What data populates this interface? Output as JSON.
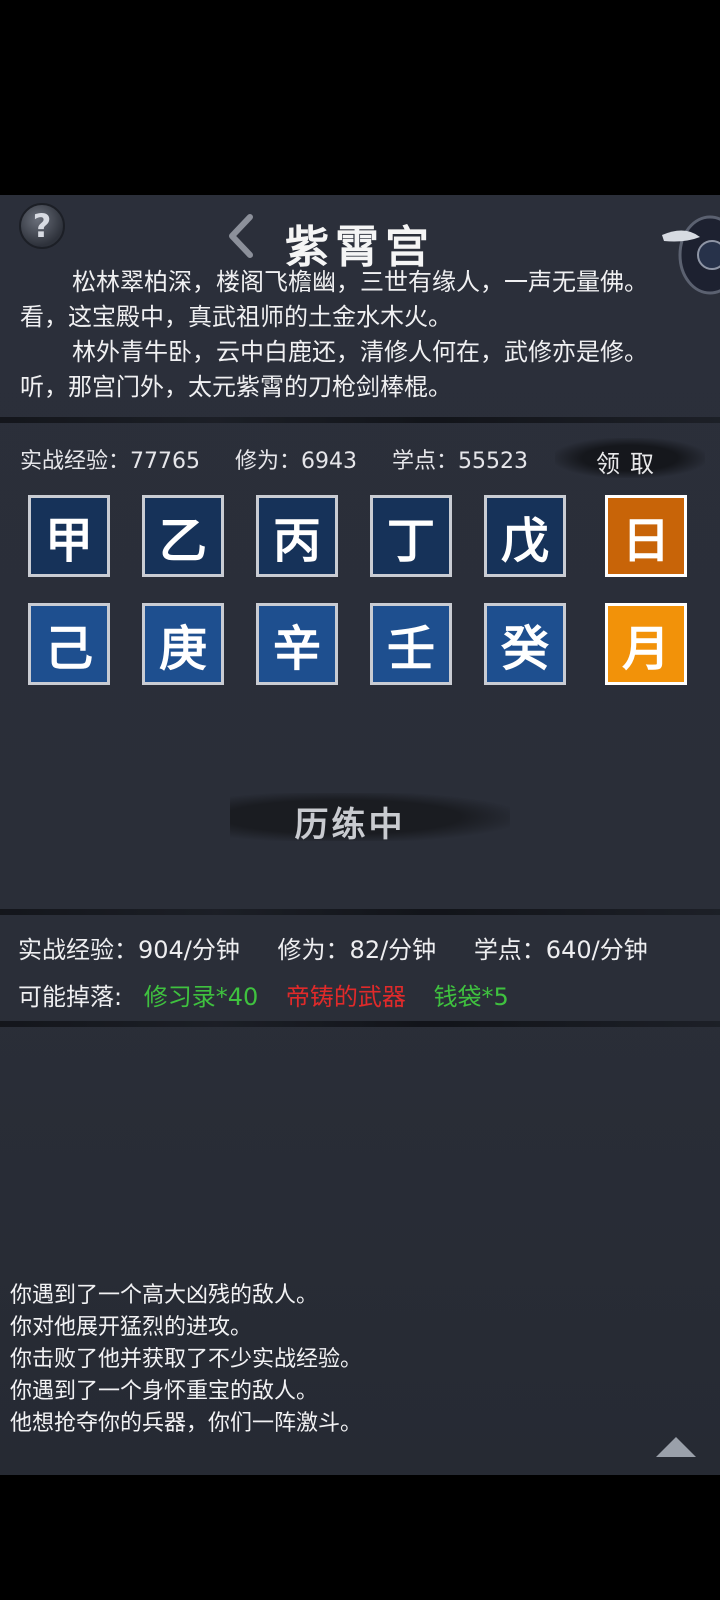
{
  "header": {
    "title": "紫霄宫",
    "help_glyph": "?"
  },
  "description": [
    "松林翠柏深，楼阁飞檐幽，三世有缘人，一声无量佛。看，这宝殿中，真武祖师的土金水木火。",
    "林外青牛卧，云中白鹿还，清修人何在，武修亦是修。听，那宫门外，太元紫霄的刀枪剑棒棍。"
  ],
  "stats": {
    "combat_exp": "实战经验：77765",
    "cultivation": "修为：6943",
    "study_points": "学点：55523",
    "claim_label": "领取"
  },
  "tiles_row1": [
    "甲",
    "乙",
    "丙",
    "丁",
    "戊",
    "日"
  ],
  "tiles_row2": [
    "己",
    "庚",
    "辛",
    "壬",
    "癸",
    "月"
  ],
  "status_label": "历练中",
  "rates": {
    "combat_exp": "实战经验：904/分钟",
    "cultivation": "修为：82/分钟",
    "study_points": "学点：640/分钟"
  },
  "drops": {
    "label": "可能掉落:",
    "items": [
      {
        "text": "修习录*40",
        "color": "#3fc13f"
      },
      {
        "text": "帝铸的武器",
        "color": "#e02a2a"
      },
      {
        "text": "钱袋*5",
        "color": "#3fc13f"
      }
    ]
  },
  "log": [
    "你遇到了一个高大凶残的敌人。",
    "你对他展开猛烈的进攻。",
    "你击败了他并获取了不少实战经验。",
    "你遇到了一个身怀重宝的敌人。",
    "他想抢夺你的兵器，你们一阵激斗。"
  ],
  "icons": {
    "help": "help-icon",
    "back": "back-chevron-icon",
    "expand": "expand-up-icon",
    "decoration": "winged-emblem-icon"
  }
}
